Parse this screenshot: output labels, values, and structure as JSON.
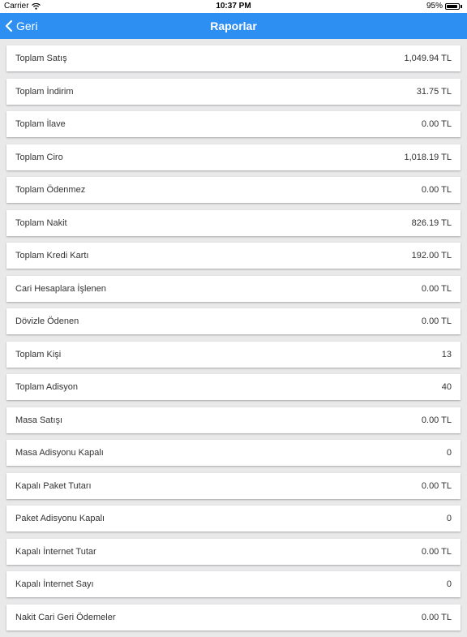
{
  "status_bar": {
    "carrier": "Carrier",
    "time": "10:37 PM",
    "battery": "95%",
    "battery_level": 0.95
  },
  "nav": {
    "back_label": "Geri",
    "title": "Raporlar"
  },
  "colors": {
    "nav_background": "#2e8ff3",
    "page_background": "#e9e9ea"
  },
  "report_rows": [
    {
      "label": "Toplam Satış",
      "value": "1,049.94 TL"
    },
    {
      "label": "Toplam İndirim",
      "value": "31.75 TL"
    },
    {
      "label": "Toplam İlave",
      "value": "0.00 TL"
    },
    {
      "label": "Toplam Ciro",
      "value": "1,018.19 TL"
    },
    {
      "label": "Toplam Ödenmez",
      "value": "0.00 TL"
    },
    {
      "label": "Toplam Nakit",
      "value": "826.19 TL"
    },
    {
      "label": "Toplam Kredi Kartı",
      "value": "192.00 TL"
    },
    {
      "label": "Cari Hesaplara İşlenen",
      "value": "0.00 TL"
    },
    {
      "label": "Dövizle Ödenen",
      "value": "0.00 TL"
    },
    {
      "label": "Toplam Kişi",
      "value": "13"
    },
    {
      "label": "Toplam Adisyon",
      "value": "40"
    },
    {
      "label": "Masa Satışı",
      "value": "0.00 TL"
    },
    {
      "label": "Masa Adisyonu Kapalı",
      "value": "0"
    },
    {
      "label": "Kapalı Paket Tutarı",
      "value": "0.00 TL"
    },
    {
      "label": "Paket Adisyonu Kapalı",
      "value": "0"
    },
    {
      "label": "Kapalı İnternet Tutar",
      "value": "0.00 TL"
    },
    {
      "label": "Kapalı İnternet Sayı",
      "value": "0"
    },
    {
      "label": "Nakit Cari Geri Ödemeler",
      "value": "0.00 TL"
    }
  ]
}
